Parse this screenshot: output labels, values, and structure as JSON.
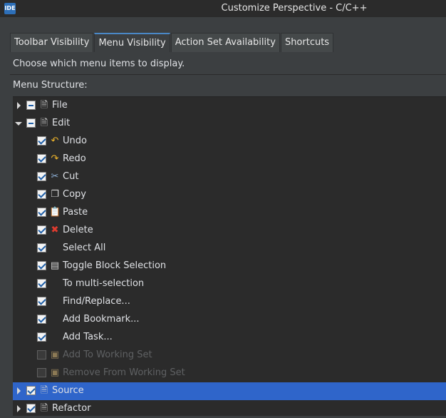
{
  "window": {
    "icon_text": "IDE",
    "title": "Customize Perspective - C/C++"
  },
  "tabs": [
    {
      "label": "Toolbar Visibility"
    },
    {
      "label": "Menu Visibility",
      "active": true
    },
    {
      "label": "Action Set Availability"
    },
    {
      "label": "Shortcuts"
    }
  ],
  "hint": "Choose which menu items to display.",
  "structure_label": "Menu Structure:",
  "tree": [
    {
      "label": "File",
      "state": "partial",
      "expander": "collapsed",
      "icon": "menu-icon"
    },
    {
      "label": "Edit",
      "state": "partial",
      "expander": "expanded",
      "icon": "menu-icon"
    },
    {
      "label": "Undo",
      "state": "checked",
      "icon": "undo-icon"
    },
    {
      "label": "Redo",
      "state": "checked",
      "icon": "redo-icon"
    },
    {
      "label": "Cut",
      "state": "checked",
      "icon": "cut-icon"
    },
    {
      "label": "Copy",
      "state": "checked",
      "icon": "copy-icon"
    },
    {
      "label": "Paste",
      "state": "checked",
      "icon": "paste-icon"
    },
    {
      "label": "Delete",
      "state": "checked",
      "icon": "delete-icon"
    },
    {
      "label": "Select All",
      "state": "checked",
      "icon": ""
    },
    {
      "label": "Toggle Block Selection",
      "state": "checked",
      "icon": "block-selection-icon"
    },
    {
      "label": "To multi-selection",
      "state": "checked",
      "icon": ""
    },
    {
      "label": "Find/Replace...",
      "state": "checked",
      "icon": ""
    },
    {
      "label": "Add Bookmark...",
      "state": "checked",
      "icon": ""
    },
    {
      "label": "Add Task...",
      "state": "checked",
      "icon": ""
    },
    {
      "label": "Add To Working Set",
      "state": "unchecked-disabled",
      "icon": "working-set-icon"
    },
    {
      "label": "Remove From Working Set",
      "state": "unchecked-disabled",
      "icon": "working-set-icon"
    },
    {
      "label": "Source",
      "state": "checked",
      "expander": "collapsed",
      "icon": "menu-icon",
      "selected": true
    },
    {
      "label": "Refactor",
      "state": "checked",
      "expander": "collapsed",
      "icon": "menu-icon"
    }
  ]
}
